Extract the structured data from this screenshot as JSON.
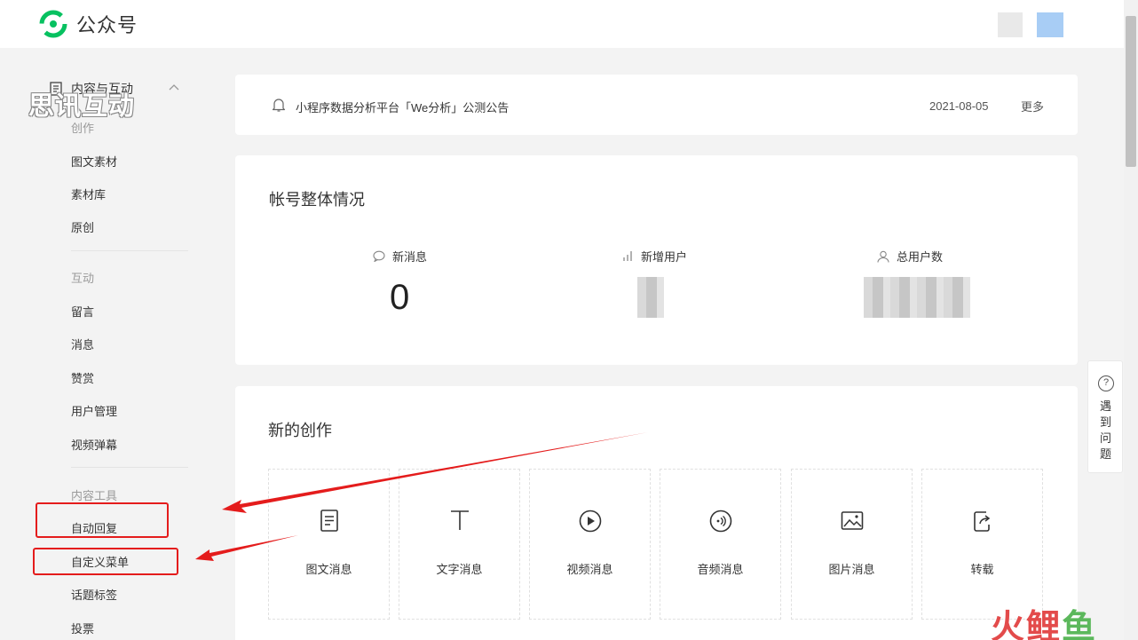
{
  "app": {
    "title": "公众号"
  },
  "sidebar": {
    "section_title": "内容与互动",
    "watermark": "思讯互动",
    "groups": [
      {
        "title": "创作",
        "items": [
          "图文素材",
          "素材库",
          "原创"
        ]
      },
      {
        "title": "互动",
        "items": [
          "留言",
          "消息",
          "赞赏",
          "用户管理",
          "视频弹幕"
        ]
      },
      {
        "title": "内容工具",
        "items": [
          "自动回复",
          "自定义菜单",
          "话题标签",
          "投票"
        ]
      }
    ]
  },
  "notice": {
    "text": "小程序数据分析平台「We分析」公测公告",
    "date": "2021-08-05",
    "more": "更多"
  },
  "overview": {
    "title": "帐号整体情况",
    "stats": [
      {
        "label": "新消息",
        "value": "0"
      },
      {
        "label": "新增用户",
        "value": ""
      },
      {
        "label": "总用户数",
        "value": ""
      }
    ]
  },
  "create": {
    "title": "新的创作",
    "tiles": [
      "图文消息",
      "文字消息",
      "视频消息",
      "音频消息",
      "图片消息",
      "转载"
    ]
  },
  "help": {
    "text": "遇到问题"
  },
  "brand": {
    "part1": "火",
    "part2": "鲤",
    "part3": "鱼"
  },
  "colors": {
    "accent": "#07c160",
    "annotation": "#e41c1c"
  }
}
